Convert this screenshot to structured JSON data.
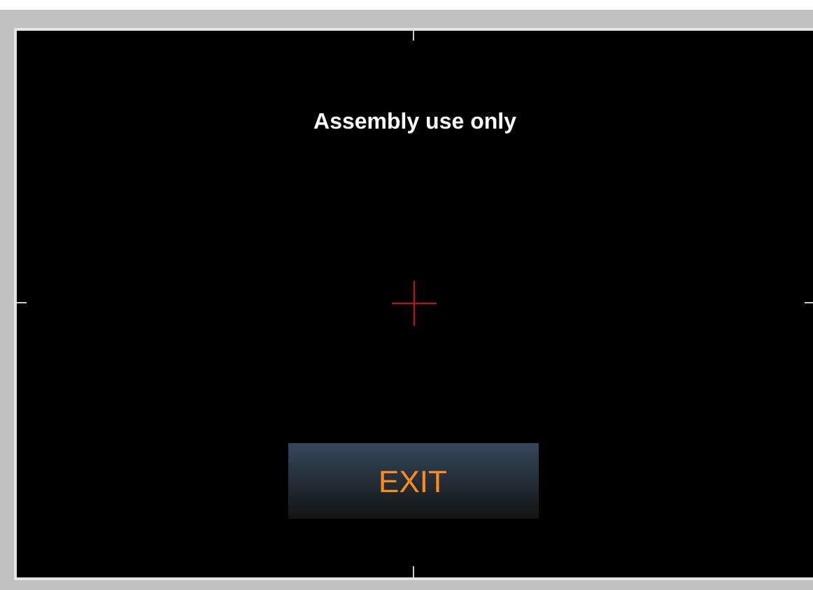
{
  "screen": {
    "title": "Assembly use only"
  },
  "button": {
    "label": "EXIT"
  }
}
